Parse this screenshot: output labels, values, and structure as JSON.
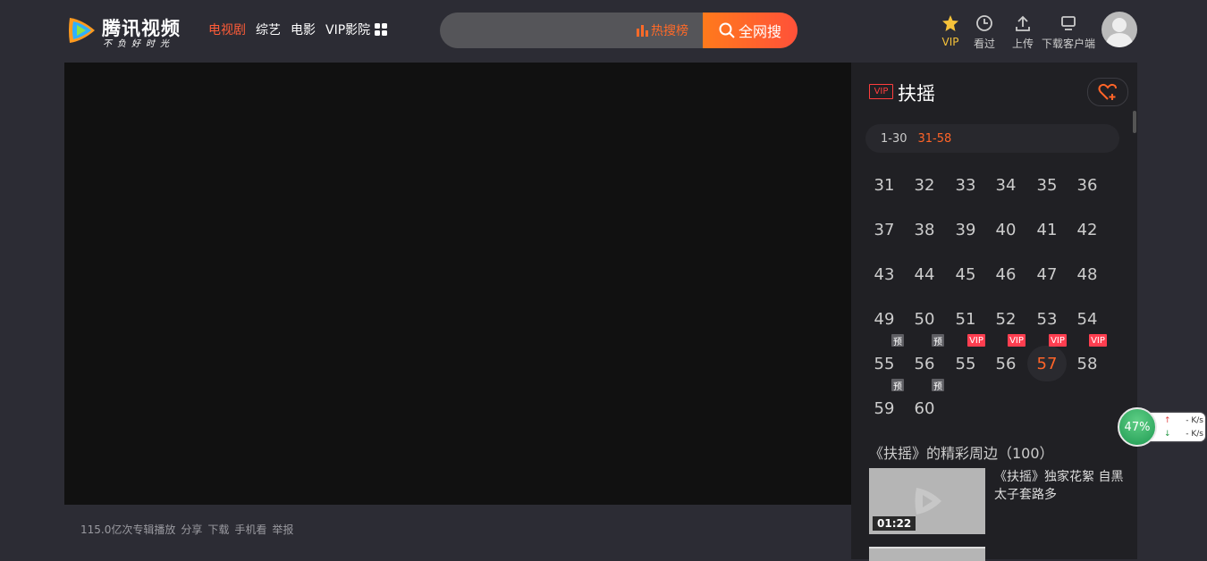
{
  "header": {
    "logo_text": "腾讯视频",
    "logo_slogan": "不负好时光",
    "nav": [
      {
        "label": "电视剧",
        "active": true
      },
      {
        "label": "综艺",
        "active": false
      },
      {
        "label": "电影",
        "active": false
      },
      {
        "label": "VIP影院",
        "active": false
      }
    ],
    "search": {
      "placeholder": "",
      "hot_label": "热搜榜",
      "button_label": "全网搜"
    },
    "tools": {
      "vip": "VIP",
      "history": "看过",
      "upload": "上传",
      "download_client": "下载客户端"
    }
  },
  "player": {
    "info": {
      "plays": "115.0亿次专辑播放",
      "share": "分享",
      "download": "下载",
      "mobile": "手机看",
      "report": "举报"
    }
  },
  "sidebar": {
    "vip_tag": "VIP",
    "title": "扶摇",
    "range_tabs": [
      {
        "label": "1-30",
        "active": false
      },
      {
        "label": "31-58",
        "active": true
      }
    ],
    "episodes": [
      {
        "n": "31"
      },
      {
        "n": "32"
      },
      {
        "n": "33"
      },
      {
        "n": "34"
      },
      {
        "n": "35"
      },
      {
        "n": "36"
      },
      {
        "n": "37"
      },
      {
        "n": "38"
      },
      {
        "n": "39"
      },
      {
        "n": "40"
      },
      {
        "n": "41"
      },
      {
        "n": "42"
      },
      {
        "n": "43"
      },
      {
        "n": "44"
      },
      {
        "n": "45"
      },
      {
        "n": "46"
      },
      {
        "n": "47"
      },
      {
        "n": "48"
      },
      {
        "n": "49"
      },
      {
        "n": "50"
      },
      {
        "n": "51"
      },
      {
        "n": "52"
      },
      {
        "n": "53"
      },
      {
        "n": "54"
      },
      {
        "n": "55",
        "badge": "预"
      },
      {
        "n": "56",
        "badge": "预"
      },
      {
        "n": "55",
        "badge": "VIP"
      },
      {
        "n": "56",
        "badge": "VIP"
      },
      {
        "n": "57",
        "badge": "VIP",
        "current": true
      },
      {
        "n": "58",
        "badge": "VIP"
      },
      {
        "n": "59",
        "badge": "预"
      },
      {
        "n": "60",
        "badge": "预"
      }
    ],
    "section_title": "《扶摇》的精彩周边（100）",
    "clips": [
      {
        "title": "《扶摇》独家花絮 自黑太子套路多",
        "duration": "01:22"
      }
    ]
  },
  "speed_widget": {
    "percent": "47%",
    "up": "- K/s",
    "down": "- K/s"
  },
  "colors": {
    "accent": "#ff6428",
    "vip_red": "#ff3e50",
    "page_bg": "#2c2c34",
    "sidebar_bg": "#202024"
  }
}
